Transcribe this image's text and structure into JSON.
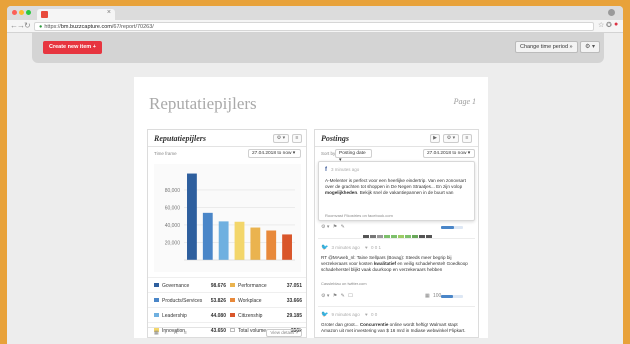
{
  "browser": {
    "url_prefix": "https://",
    "url_host": "bm.buzzcapture.com",
    "url_path": "/67/report/70263/",
    "tab_close": "×"
  },
  "toolbar": {
    "create_label": "Create new item +",
    "change_period_label": "Change time period »",
    "settings_label": "⚙ ▾"
  },
  "report": {
    "title": "Reputatiepijlers",
    "page": "Page 1"
  },
  "left_panel": {
    "title": "Reputatiepijlers",
    "timeframe_label": "Time frame",
    "timeframe_value": "27.04.2018 to now ▾",
    "chart_data": {
      "type": "bar",
      "categories": [
        "Governance",
        "Products/Services",
        "Leadership",
        "Innovation",
        "Performance",
        "Workplace",
        "Citizenship"
      ],
      "values": [
        98676,
        53826,
        44080,
        43650,
        37051,
        33666,
        29185
      ],
      "colors": [
        "#2e5f9e",
        "#4a86c8",
        "#6fb0e0",
        "#f3d66a",
        "#eab34f",
        "#e8893a",
        "#d9562b"
      ],
      "yticks": [
        "80,000",
        "60,000",
        "40,000",
        "20,000"
      ],
      "ytick_values": [
        80000,
        60000,
        40000,
        20000
      ],
      "ylim": [
        0,
        105000
      ],
      "grid": true
    },
    "legend": [
      {
        "name": "Governance",
        "value": "98.676",
        "color": "#2e5f9e"
      },
      {
        "name": "Performance",
        "value": "37.051",
        "color": "#eab34f"
      },
      {
        "name": "Products/Services",
        "value": "53.826",
        "color": "#4a86c8"
      },
      {
        "name": "Workplace",
        "value": "33.666",
        "color": "#e8893a"
      },
      {
        "name": "Leadership",
        "value": "44.080",
        "color": "#6fb0e0"
      },
      {
        "name": "Citizenship",
        "value": "29.185",
        "color": "#d9562b"
      },
      {
        "name": "Innovation",
        "value": "43.650",
        "color": "#f3d66a"
      },
      {
        "name": "Total volume",
        "value": "350k",
        "color": "#ffffff"
      }
    ],
    "view_details": "View details »"
  },
  "right_panel": {
    "title": "Postings",
    "sort_label": "Sort by",
    "sort_value": "Posting date ▾",
    "date_value": "27.04.2018 to now ▾",
    "posts": [
      {
        "time": "3 minutes ago",
        "text": "A-Melenter is perfect voor een heerlijke eindertrip. Van een zonovsart over de grachten tot shoppen in De Negen Straatjes... En zijn volop ",
        "bold": "mogelijkheden",
        "text2": ". Bekijk snel de vakantiepannen in de buurt van",
        "source": "Roomvast Fikostries on facebook.com"
      },
      {
        "time": "3 minutes ago",
        "counts": "0   0   1",
        "text": "RT @MAweb_nl: Taine Sellpars (Bovag): Steeds meer begrip bij verzekeraars voor kosten ",
        "bold": "kwalitatief",
        "text2": " en veilig schadeherstel! Goedkoop schadeherstel blijkt vaak duurkoop en verzekeraars hebben",
        "source": "Cassleblau on twitter.com"
      },
      {
        "time": "9 minutes ago",
        "counts": "0   0",
        "text": "Groter dan groot... ",
        "bold": "Concurrentie",
        "text2": " online wordt heftig! Walmart stapt Amazon uit met investering van $ 16 mrd in Indiase webwinkel Flipkart."
      }
    ],
    "views_count": "100"
  }
}
